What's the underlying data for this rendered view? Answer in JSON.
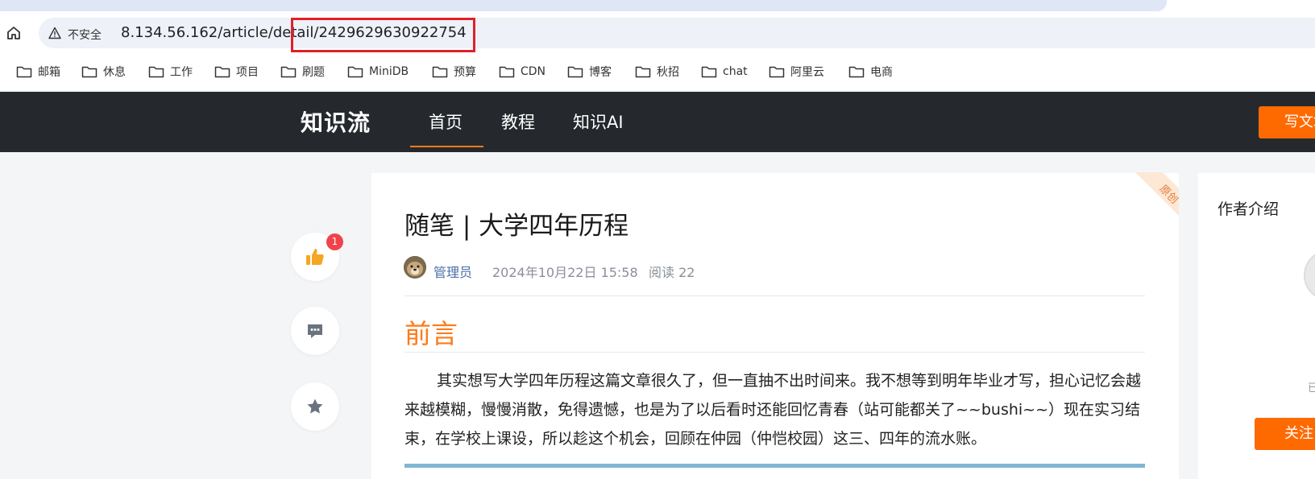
{
  "browser": {
    "insecure_label": "不安全",
    "url": "8.134.56.162/article/detail/2429629630922754",
    "bookmarks": [
      "邮箱",
      "休息",
      "工作",
      "项目",
      "刷题",
      "MiniDB",
      "预算",
      "CDN",
      "博客",
      "秋招",
      "chat",
      "阿里云",
      "电商"
    ]
  },
  "site": {
    "logo": "知识流",
    "nav": [
      "首页",
      "教程",
      "知识AI"
    ],
    "write_button": "写文章"
  },
  "actions": {
    "like_count": "1"
  },
  "article": {
    "ribbon": "原创",
    "title": "随笔 | 大学四年历程",
    "author": "管理员",
    "date": "2024年10月22日 15:58",
    "views": "阅读 22",
    "section_heading": "前言",
    "paragraph": "其实想写大学四年历程这篇文章很久了，但一直抽不出时间来。我不想等到明年毕业才写，担心记忆会越来越模糊，慢慢消散，免得遗憾，也是为了以后看时还能回忆青春（站可能都关了~~bushi~~）现在实习结束，在学校上课设，所以趁这个机会，回顾在仲园（仲恺校园）这三、四年的流水账。"
  },
  "sidebar": {
    "title": "作者介绍",
    "follow_button": "关注",
    "small_text": "已"
  },
  "colors": {
    "accent": "#ff6a00",
    "header_bg": "#25292e",
    "highlight_box": "#e0202a",
    "link": "#4a6ea8"
  }
}
